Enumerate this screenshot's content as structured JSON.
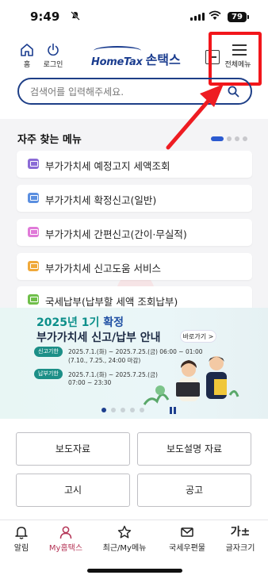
{
  "status_bar": {
    "time": "9:49",
    "battery": "79"
  },
  "header": {
    "home_label": "홈",
    "login_label": "로그인",
    "logo_en": "HomeTax",
    "logo_ko": "손택스",
    "menu_label": "전체메뉴"
  },
  "search": {
    "placeholder": "검색어를 입력해주세요."
  },
  "frequent": {
    "title": "자주 찾는 메뉴",
    "items": [
      {
        "label": "부가가치세 예정고지 세액조회",
        "color": "#8b6bd6"
      },
      {
        "label": "부가가치세 확정신고(일반)",
        "color": "#5b8fe0"
      },
      {
        "label": "부가가치세 간편신고(간이·무실적)",
        "color": "#e07ad8"
      },
      {
        "label": "부가가치세 신고도움 서비스",
        "color": "#f0a93a"
      },
      {
        "label": "국세납부(납부할 세액 조회납부)",
        "color": "#6fbf4a"
      }
    ]
  },
  "banner": {
    "year": "2025년 1기",
    "title1_rest": " 확정",
    "title2": "부가가치세 신고/납부 안내",
    "link": "바로가기 >",
    "report_badge": "신고기한",
    "report_line1": "2025.7.1.(화) ~ 2025.7.25.(금) 06:00 ~ 01:00",
    "report_line2": "(7.10., 7.25., 24:00 마감)",
    "pay_badge": "납부기한",
    "pay_line1": "2025.7.1.(화) ~ 2025.7.25.(금)",
    "pay_line2": "07:00 ~ 23:30"
  },
  "buttons": {
    "press": "보도자료",
    "explain": "보도설명 자료",
    "notice": "고시",
    "announce": "공고"
  },
  "bottom_nav": {
    "alarm": "알림",
    "my": "My홈택스",
    "recent": "최근/My메뉴",
    "mailbox": "국세우편물",
    "font": "글자크기",
    "font_icon": "가±"
  }
}
